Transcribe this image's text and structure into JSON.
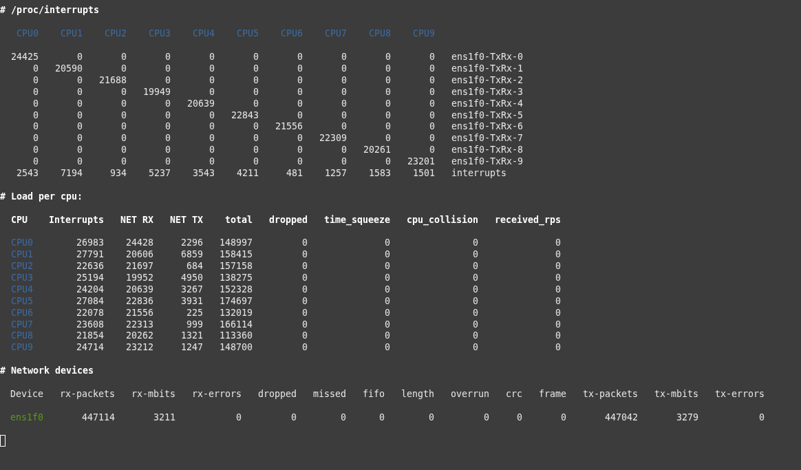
{
  "interrupts": {
    "title": "# /proc/interrupts",
    "cpus": [
      "CPU0",
      "CPU1",
      "CPU2",
      "CPU3",
      "CPU4",
      "CPU5",
      "CPU6",
      "CPU7",
      "CPU8",
      "CPU9"
    ],
    "rows": [
      {
        "values": [
          "24425",
          "0",
          "0",
          "0",
          "0",
          "0",
          "0",
          "0",
          "0",
          "0"
        ],
        "name": "ens1f0-TxRx-0"
      },
      {
        "values": [
          "0",
          "20590",
          "0",
          "0",
          "0",
          "0",
          "0",
          "0",
          "0",
          "0"
        ],
        "name": "ens1f0-TxRx-1"
      },
      {
        "values": [
          "0",
          "0",
          "21688",
          "0",
          "0",
          "0",
          "0",
          "0",
          "0",
          "0"
        ],
        "name": "ens1f0-TxRx-2"
      },
      {
        "values": [
          "0",
          "0",
          "0",
          "19949",
          "0",
          "0",
          "0",
          "0",
          "0",
          "0"
        ],
        "name": "ens1f0-TxRx-3"
      },
      {
        "values": [
          "0",
          "0",
          "0",
          "0",
          "20639",
          "0",
          "0",
          "0",
          "0",
          "0"
        ],
        "name": "ens1f0-TxRx-4"
      },
      {
        "values": [
          "0",
          "0",
          "0",
          "0",
          "0",
          "22843",
          "0",
          "0",
          "0",
          "0"
        ],
        "name": "ens1f0-TxRx-5"
      },
      {
        "values": [
          "0",
          "0",
          "0",
          "0",
          "0",
          "0",
          "21556",
          "0",
          "0",
          "0"
        ],
        "name": "ens1f0-TxRx-6"
      },
      {
        "values": [
          "0",
          "0",
          "0",
          "0",
          "0",
          "0",
          "0",
          "22309",
          "0",
          "0"
        ],
        "name": "ens1f0-TxRx-7"
      },
      {
        "values": [
          "0",
          "0",
          "0",
          "0",
          "0",
          "0",
          "0",
          "0",
          "20261",
          "0"
        ],
        "name": "ens1f0-TxRx-8"
      },
      {
        "values": [
          "0",
          "0",
          "0",
          "0",
          "0",
          "0",
          "0",
          "0",
          "0",
          "23201"
        ],
        "name": "ens1f0-TxRx-9"
      },
      {
        "values": [
          "2543",
          "7194",
          "934",
          "5237",
          "3543",
          "4211",
          "481",
          "1257",
          "1583",
          "1501"
        ],
        "name": "interrupts"
      }
    ]
  },
  "load": {
    "title": "# Load per cpu:",
    "columns": [
      "CPU",
      "Interrupts",
      "NET RX",
      "NET TX",
      "total",
      "dropped",
      "time_squeeze",
      "cpu_collision",
      "received_rps"
    ],
    "rows": [
      {
        "cpu": "CPU0",
        "values": [
          "26983",
          "24428",
          "2296",
          "148997",
          "0",
          "0",
          "0",
          "0"
        ]
      },
      {
        "cpu": "CPU1",
        "values": [
          "27791",
          "20606",
          "6859",
          "158415",
          "0",
          "0",
          "0",
          "0"
        ]
      },
      {
        "cpu": "CPU2",
        "values": [
          "22636",
          "21697",
          "684",
          "157158",
          "0",
          "0",
          "0",
          "0"
        ]
      },
      {
        "cpu": "CPU3",
        "values": [
          "25194",
          "19952",
          "4950",
          "138275",
          "0",
          "0",
          "0",
          "0"
        ]
      },
      {
        "cpu": "CPU4",
        "values": [
          "24204",
          "20639",
          "3267",
          "152328",
          "0",
          "0",
          "0",
          "0"
        ]
      },
      {
        "cpu": "CPU5",
        "values": [
          "27084",
          "22836",
          "3931",
          "174697",
          "0",
          "0",
          "0",
          "0"
        ]
      },
      {
        "cpu": "CPU6",
        "values": [
          "22078",
          "21556",
          "225",
          "132019",
          "0",
          "0",
          "0",
          "0"
        ]
      },
      {
        "cpu": "CPU7",
        "values": [
          "23608",
          "22313",
          "999",
          "166114",
          "0",
          "0",
          "0",
          "0"
        ]
      },
      {
        "cpu": "CPU8",
        "values": [
          "21854",
          "20262",
          "1321",
          "113360",
          "0",
          "0",
          "0",
          "0"
        ]
      },
      {
        "cpu": "CPU9",
        "values": [
          "24714",
          "23212",
          "1247",
          "148700",
          "0",
          "0",
          "0",
          "0"
        ]
      }
    ]
  },
  "network": {
    "title": "# Network devices",
    "columns": [
      "Device",
      "rx-packets",
      "rx-mbits",
      "rx-errors",
      "dropped",
      "missed",
      "fifo",
      "length",
      "overrun",
      "crc",
      "frame",
      "tx-packets",
      "tx-mbits",
      "tx-errors"
    ],
    "rows": [
      {
        "device": "ens1f0",
        "values": [
          "447114",
          "3211",
          "0",
          "0",
          "0",
          "0",
          "0",
          "0",
          "0",
          "0",
          "447042",
          "3279",
          "0"
        ]
      }
    ]
  }
}
